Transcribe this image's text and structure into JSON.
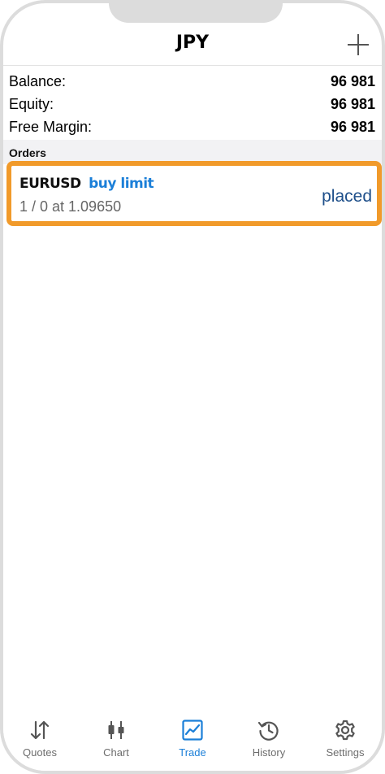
{
  "header": {
    "title": "JPY"
  },
  "account": {
    "balance_label": "Balance:",
    "balance_value": "96 981",
    "equity_label": "Equity:",
    "equity_value": "96 981",
    "free_margin_label": "Free Margin:",
    "free_margin_value": "96 981"
  },
  "orders": {
    "section_label": "Orders",
    "items": [
      {
        "symbol": "EURUSD",
        "type": "buy limit",
        "detail": "1 / 0 at 1.09650",
        "status": "placed"
      }
    ]
  },
  "tabbar": {
    "active": "Trade",
    "accent_color": "#1b7fd8",
    "items": [
      {
        "label": "Quotes",
        "icon": "quotes-icon"
      },
      {
        "label": "Chart",
        "icon": "chart-icon"
      },
      {
        "label": "Trade",
        "icon": "trade-icon"
      },
      {
        "label": "History",
        "icon": "history-icon"
      },
      {
        "label": "Settings",
        "icon": "settings-icon"
      }
    ]
  },
  "highlight_color": "#f19a2a"
}
